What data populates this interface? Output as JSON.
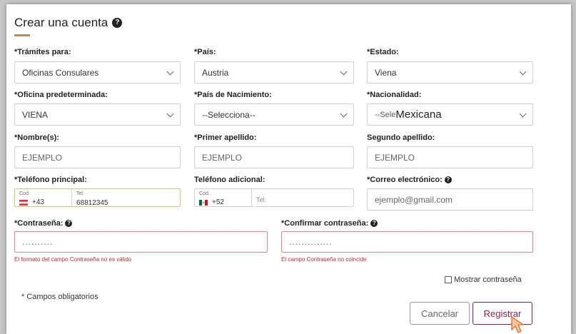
{
  "title": "Crear una cuenta",
  "fields": {
    "tramites": {
      "label": "*Trámites para:",
      "value": "Oficinas Consulares"
    },
    "pais": {
      "label": "*País:",
      "value": "Austria"
    },
    "estado": {
      "label": "*Estado:",
      "value": "Viena"
    },
    "oficina": {
      "label": "*Oficina predeterminada:",
      "value": "VIENA"
    },
    "pais_nacimiento": {
      "label": "*País de Nacimiento:",
      "value": "--Selecciona--"
    },
    "nacionalidad": {
      "label": "*Nacionalidad:",
      "value_prefix": "--Sele",
      "value": "Mexicana"
    },
    "nombre": {
      "label": "*Nombre(s):",
      "value": "EJEMPLO"
    },
    "primer_apellido": {
      "label": "*Primer apellido:",
      "value": "EJEMPLO"
    },
    "segundo_apellido": {
      "label": "Segundo apellido:",
      "value": "EJEMPLO"
    },
    "tel_principal": {
      "label": "*Teléfono principal:",
      "cod_label": "Cod.",
      "code": "+43",
      "tel_label": "Tel.",
      "number": "68812345"
    },
    "tel_adicional": {
      "label": "Teléfono adicional:",
      "cod_label": "Cod.",
      "code": "+52",
      "tel_placeholder": "Tel."
    },
    "correo": {
      "label": "*Correo electrónico:",
      "value": "ejemplo@gmail.com"
    },
    "contrasena": {
      "label": "*Contraseña:",
      "value": "..........",
      "error": "El formato del campo Contraseña no es válido"
    },
    "confirmar": {
      "label": "*Confirmar contraseña:",
      "value": "..............",
      "error": "El campo Contraseña no coincide"
    }
  },
  "show_password_label": "Mostrar contraseña",
  "required_note": "* Campos obligatorios",
  "buttons": {
    "cancel": "Cancelar",
    "register": "Registrar"
  },
  "colors": {
    "accent": "#b38e5d",
    "register": "#8b2245",
    "error": "#b53030",
    "valid_border": "#b9d27a"
  }
}
